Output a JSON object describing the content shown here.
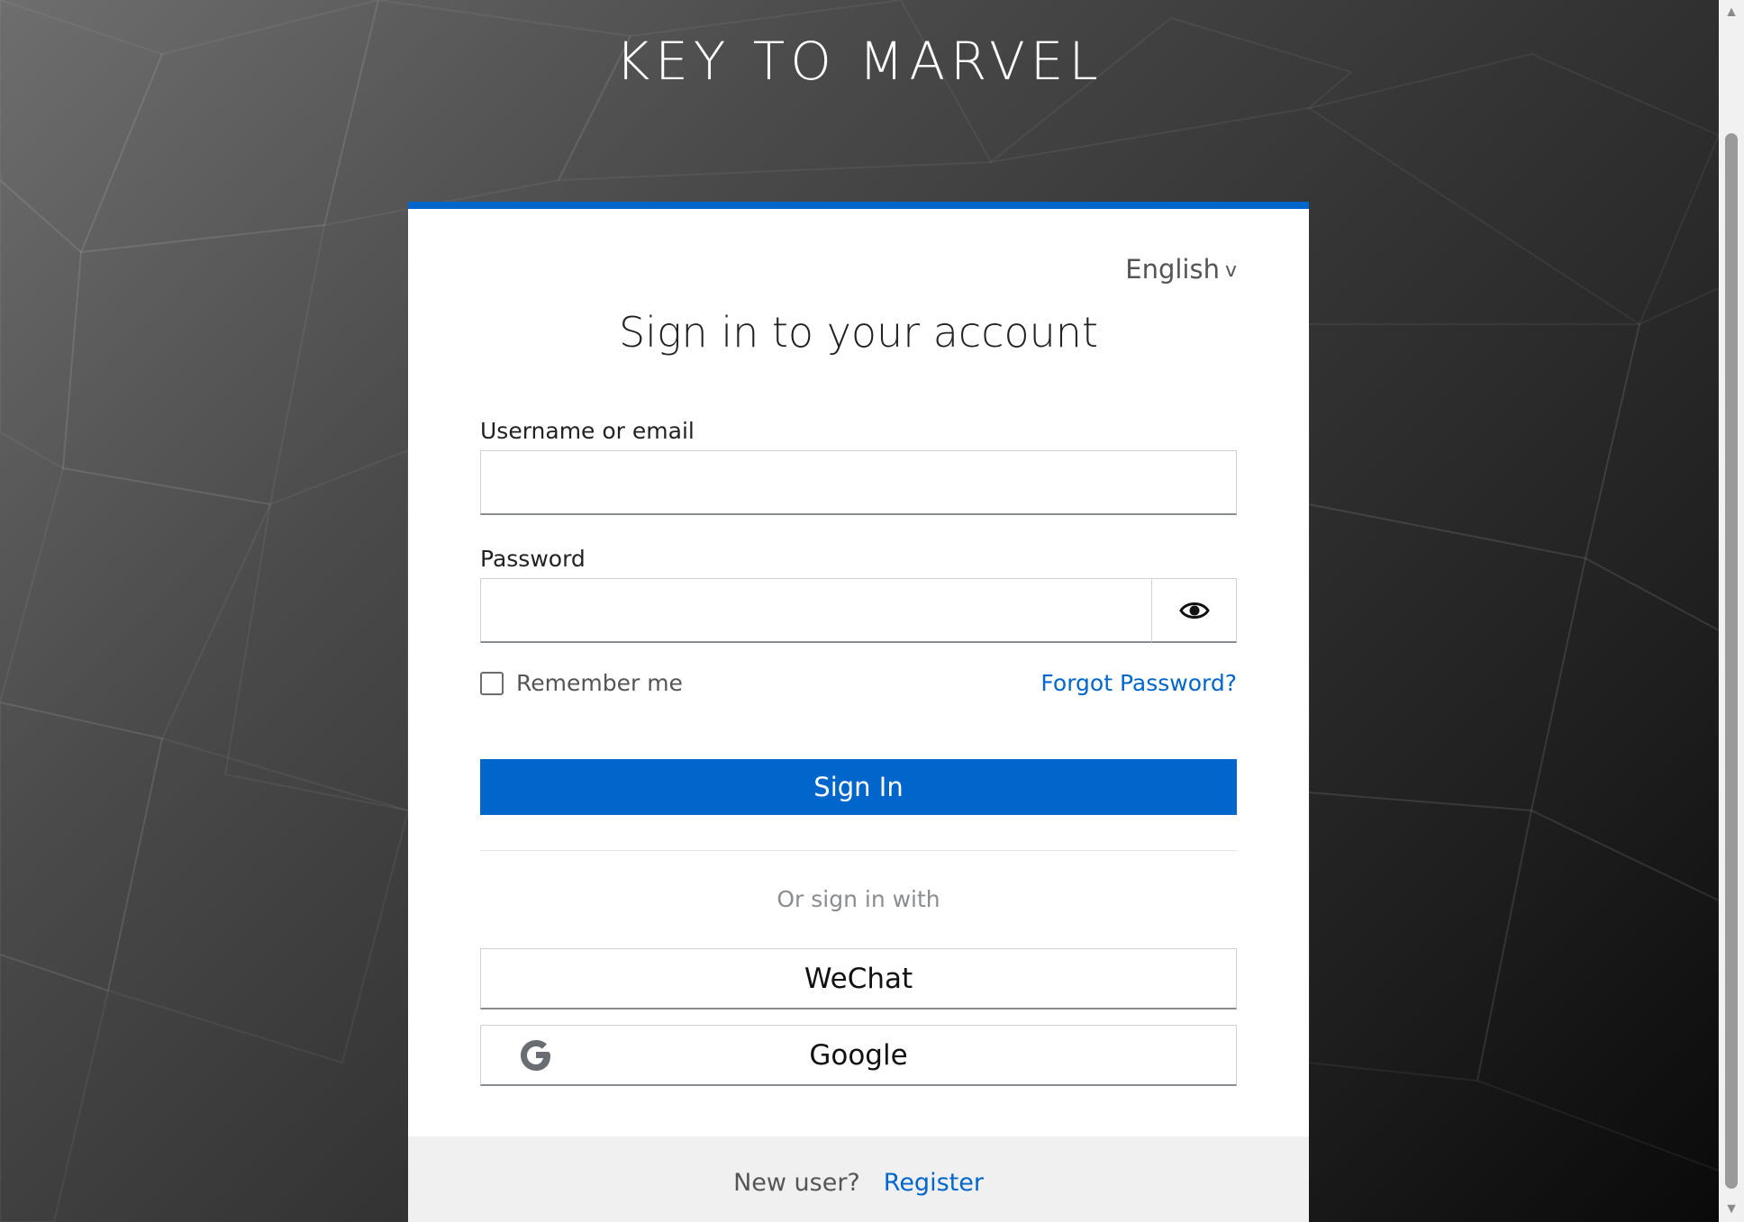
{
  "brand": {
    "title": "KEY TO MARVEL"
  },
  "card": {
    "language": "English",
    "title": "Sign in to your account",
    "username_label": "Username or email",
    "username_value": "",
    "password_label": "Password",
    "password_value": "",
    "remember_label": "Remember me",
    "forgot_label": "Forgot Password?",
    "signin_label": "Sign In",
    "or_label": "Or sign in with",
    "social": [
      {
        "label": "WeChat"
      },
      {
        "label": "Google",
        "icon": "google-icon"
      }
    ],
    "footer": {
      "new_user": "New user?",
      "register": "Register"
    }
  },
  "colors": {
    "accent": "#0066cc",
    "footer_bg": "#f0f0f0"
  },
  "icons": {
    "language": "chevron-down-icon",
    "password_toggle": "eye-icon"
  }
}
